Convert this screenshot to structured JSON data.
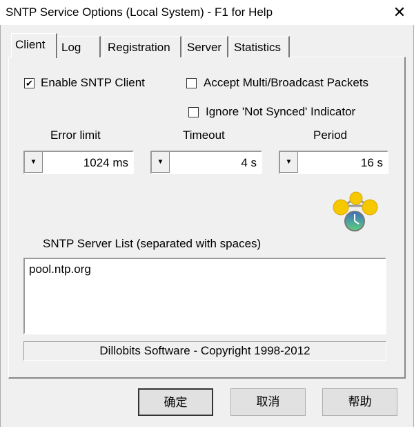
{
  "window": {
    "title": "SNTP Service Options (Local System) - F1 for Help",
    "close": "✕"
  },
  "tabs": [
    {
      "label": "Client",
      "active": true
    },
    {
      "label": "Log"
    },
    {
      "label": "Registration"
    },
    {
      "label": "Server"
    },
    {
      "label": "Statistics"
    }
  ],
  "client": {
    "enable_sntp": {
      "label": "Enable SNTP Client",
      "checked": true,
      "mark": "✔"
    },
    "accept_broadcast": {
      "label": "Accept Multi/Broadcast Packets",
      "checked": false
    },
    "ignore_not_synced": {
      "label": "Ignore 'Not Synced' Indicator",
      "checked": false
    },
    "error_limit": {
      "label": "Error limit",
      "value": "1024 ms"
    },
    "timeout": {
      "label": "Timeout",
      "value": "4 s"
    },
    "period": {
      "label": "Period",
      "value": "16 s"
    },
    "dropdown_glyph": "▼",
    "icon": "network-clock-icon",
    "server_list_label": "SNTP Server List (separated with spaces)",
    "server_list": "pool.ntp.org",
    "copyright": "Dillobits Software - Copyright 1998-2012"
  },
  "buttons": {
    "ok": "确定",
    "cancel": "取消",
    "help": "帮助"
  }
}
